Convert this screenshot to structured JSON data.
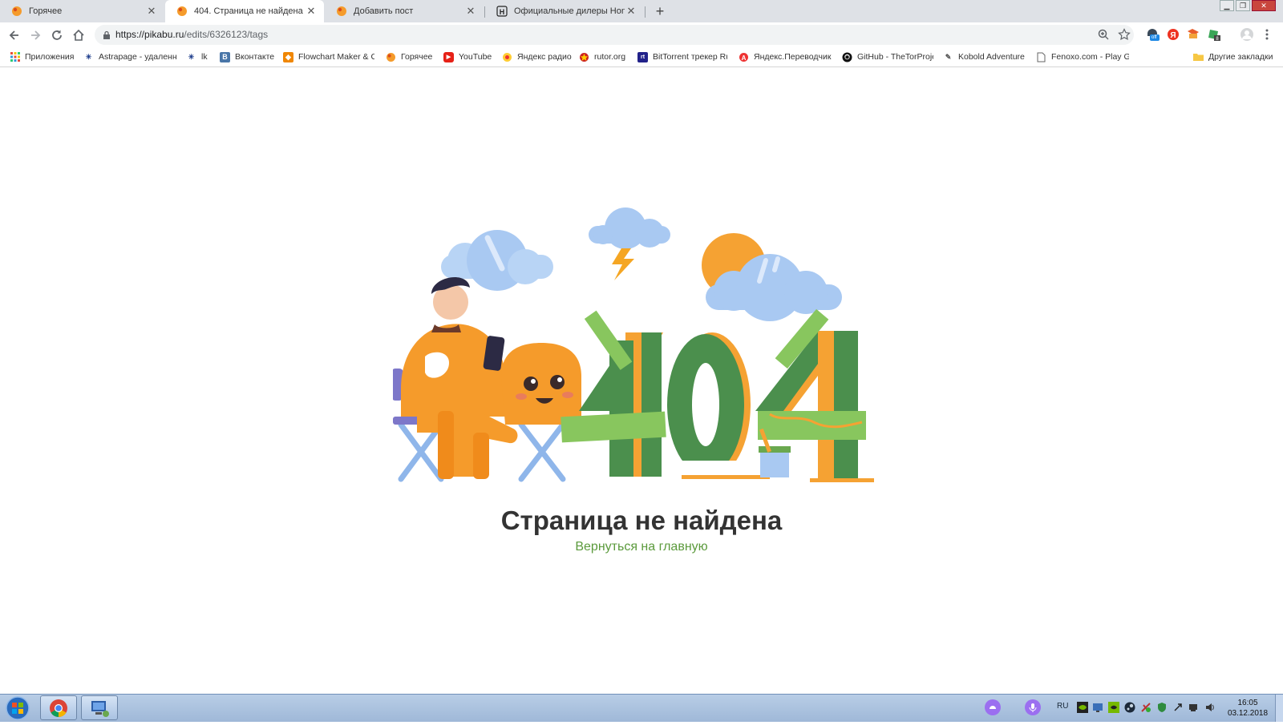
{
  "tabs": [
    {
      "title": "Горячее",
      "favicon": "pikabu-icon"
    },
    {
      "title": "404. Страница не найдена",
      "favicon": "pikabu-icon"
    },
    {
      "title": "Добавить пост",
      "favicon": "pikabu-icon"
    },
    {
      "title": "Официальные дилеры Honda (О",
      "favicon": "honda-icon"
    }
  ],
  "address": {
    "host": "https://pikabu.ru",
    "path": "/edits/6326123/tags"
  },
  "bookmarks": [
    {
      "label": "Приложения",
      "icon": "apps-grid-icon"
    },
    {
      "label": "Astrapage - удаленн",
      "icon": "astra-icon"
    },
    {
      "label": "lk",
      "icon": "astra-icon"
    },
    {
      "label": "Вконтакте",
      "icon": "vk-icon"
    },
    {
      "label": "Flowchart Maker & C",
      "icon": "drawio-icon"
    },
    {
      "label": "Горячее",
      "icon": "pikabu-icon"
    },
    {
      "label": "YouTube",
      "icon": "youtube-icon"
    },
    {
      "label": "Яндекс радио",
      "icon": "yandex-radio-icon"
    },
    {
      "label": "rutor.org",
      "icon": "rutor-icon"
    },
    {
      "label": "BitTorrent трекер Ru",
      "icon": "rutracker-icon"
    },
    {
      "label": "Яндекс.Переводчик",
      "icon": "translate-icon"
    },
    {
      "label": "GitHub - TheTorProje",
      "icon": "github-icon"
    },
    {
      "label": "Kobold Adventure",
      "icon": "kobold-icon"
    },
    {
      "label": "Fenoxo.com - Play G",
      "icon": "page-icon"
    },
    {
      "label": "Другие закладки",
      "icon": "folder-icon"
    }
  ],
  "page": {
    "heading": "Страница не найдена",
    "home_link": "Вернуться на главную",
    "illustration_number": "404"
  },
  "extensions": {
    "badge_off": "off"
  },
  "taskbar": {
    "lang": "RU",
    "time": "16:05",
    "date": "03.12.2018"
  },
  "colors": {
    "link_green": "#5b9a3c",
    "heading": "#333333",
    "tabstrip": "#dee1e6"
  }
}
